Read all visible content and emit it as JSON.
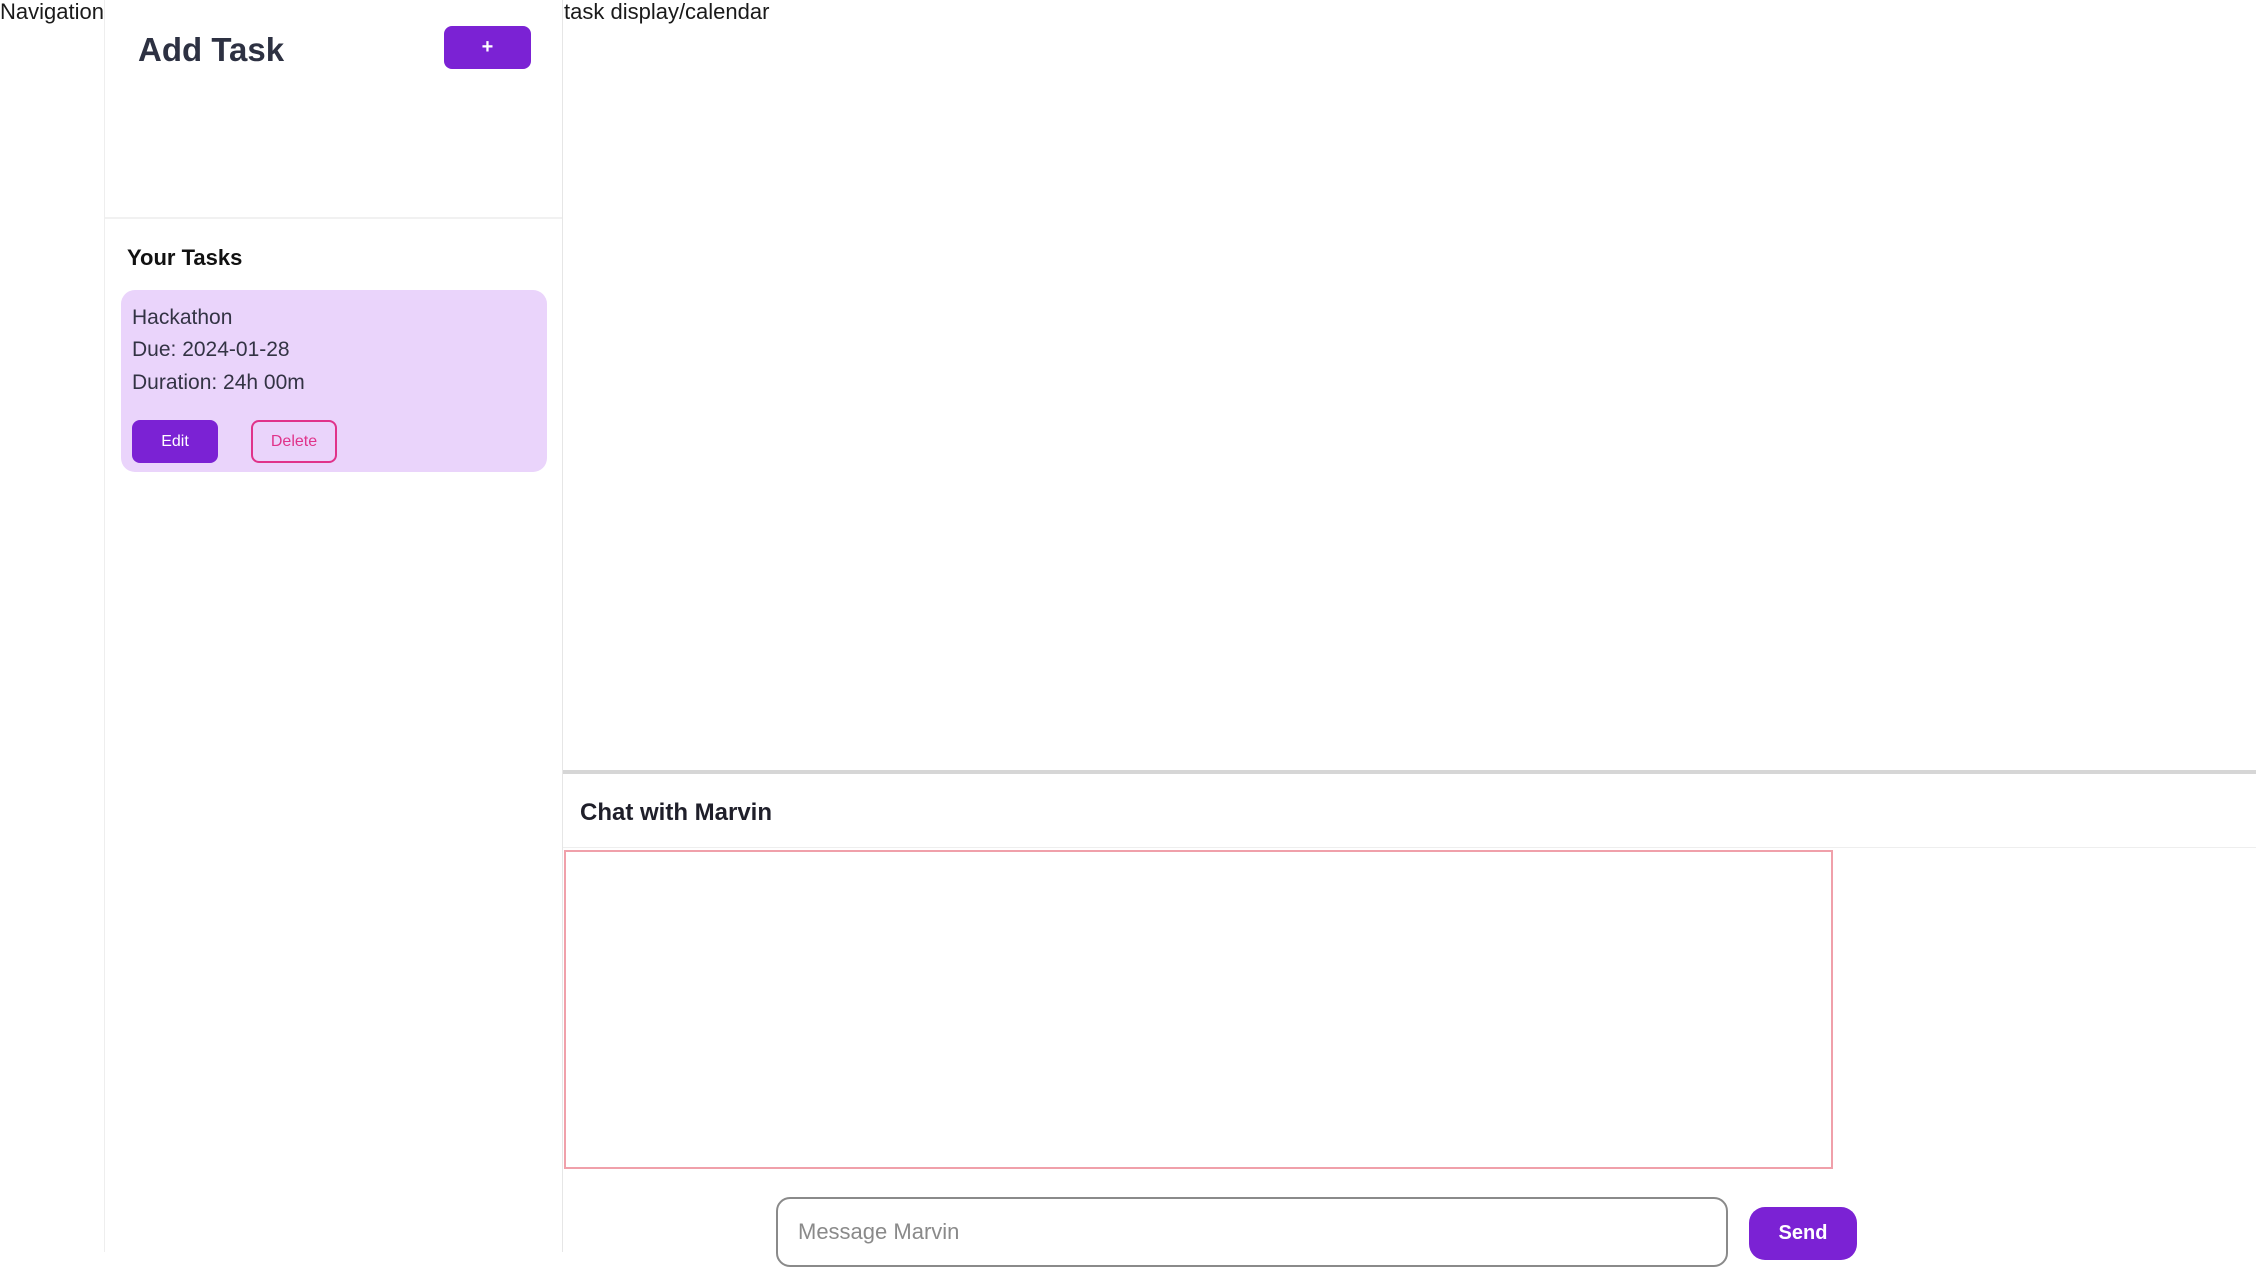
{
  "navigation": {
    "label": "Navigation"
  },
  "sidebar": {
    "add_task_title": "Add Task",
    "add_button_label": "+",
    "your_tasks_title": "Your Tasks",
    "tasks": [
      {
        "name": "Hackathon",
        "due": "Due: 2024-01-28",
        "duration": "Duration: 24h 00m",
        "edit_label": "Edit",
        "delete_label": "Delete"
      }
    ]
  },
  "main": {
    "display_label": "task display/calendar"
  },
  "chat": {
    "title": "Chat with Marvin",
    "input_placeholder": "Message Marvin",
    "send_label": "Send"
  },
  "colors": {
    "accent": "#7b22d4",
    "task_card_bg": "#ead4fb",
    "delete_accent": "#e0338a",
    "chat_box_border": "#f0a0aa"
  }
}
